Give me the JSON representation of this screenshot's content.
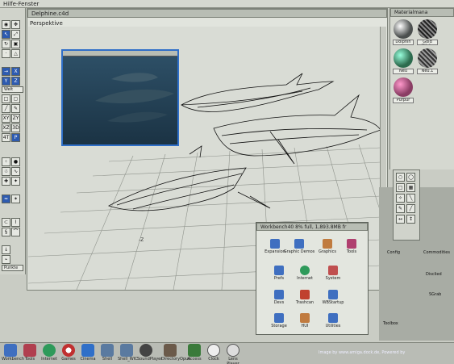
{
  "topbar": {
    "title": "Hilfe-Fenster"
  },
  "viewport": {
    "window_title": "Delphine.c4d",
    "view_label": "Perspektive",
    "axis_label": "-Z"
  },
  "toolbar": {
    "buttons": [
      "XY",
      "ZY",
      "XZ",
      "3D",
      "4T",
      "P"
    ],
    "welt1": "Welt",
    "welt2": "Welt",
    "punkte": "Punkte"
  },
  "materials": {
    "window_title": "Materialmana",
    "items": [
      {
        "label": "Dolphin",
        "color": "#4b4f4e"
      },
      {
        "label": "Gold Kitch.",
        "color": "#3a3f3d"
      },
      {
        "label": "Neu",
        "color": "#2d6b4e"
      },
      {
        "label": "Neu.1",
        "color": "#575b59"
      },
      {
        "label": "Purpur",
        "color": "#8a3d64"
      }
    ]
  },
  "workbench": {
    "title": "Workbench40  8% full, 1,893.8MB fr",
    "icons": [
      "Expansion",
      "Graphic Demos",
      "Graphics",
      "Tools",
      "Prefs",
      "Internet",
      "System",
      "Devs",
      "Trashcan",
      "WBStartup",
      "Storage",
      "HUI",
      "Utilities"
    ]
  },
  "background_wb": {
    "labels": [
      "Config",
      "Commodities",
      "Disclied",
      "SGrab",
      "Toolbox"
    ]
  },
  "dock": {
    "items": [
      "Workbench",
      "Tools",
      "Internet",
      "Games",
      "Cinema",
      "Shell",
      "Shell_WIC",
      "SoundPlayer",
      "DirectoryOpus",
      "Access",
      "Clock",
      "Lens Player"
    ],
    "status": "Image by www.amiga.dock.de, Powered by"
  }
}
